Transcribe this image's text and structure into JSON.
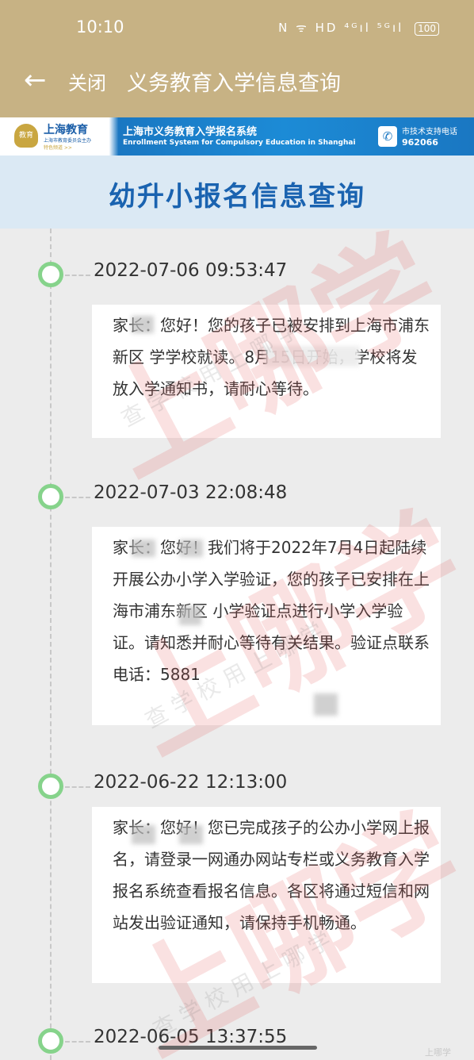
{
  "status_bar": {
    "time": "10:10",
    "icons_text": "N ᯤ HD ⁴ᴳıl ⁵ᴳıl",
    "battery": "100"
  },
  "nav": {
    "back_icon": "arrow-left-icon",
    "close_label": "关闭",
    "title": "义务教育入学信息查询"
  },
  "banner": {
    "logo_text": "教育",
    "brand": "上海教育",
    "brand_sub": "上海市教育委员会主办",
    "brand_sub2": "特色频道 >>",
    "system_title": "上海市义务教育入学报名系统",
    "system_title_en": "Enrollment System for Compulsory Education in Shanghai",
    "phone_icon": "phone-icon",
    "support_label": "市技术支持电话",
    "support_phone": "962066"
  },
  "page_title": "幼升小报名信息查询",
  "timeline": [
    {
      "time": "2022-07-06 09:53:47",
      "message": "家长：您好！您的孩子已被安排到上海市浦东新区 学学校就读。8月15日开始，学校将发放入学通知书，请耐心等待。"
    },
    {
      "time": "2022-07-03 22:08:48",
      "message": "家长：您好！我们将于2022年7月4日起陆续开展公办小学入学验证，您的孩子已安排在上海市浦东新区 小学验证点进行小学入学验证。请知悉并耐心等待有关结果。验证点联系电话：5881"
    },
    {
      "time": "2022-06-22 12:13:00",
      "message": "家长：您好！您已完成孩子的公办小学网上报名，请登录一网通办网站专栏或义务教育入学报名系统查看报名信息。各区将通过短信和网站发出验证通知，请保持手机畅通。"
    },
    {
      "time": "2022-06-05 13:37:55"
    }
  ],
  "watermarks": {
    "large": "上哪学",
    "small_1": "查 学 校 用 上 哪 学",
    "small_2": "查 学 校 用 上 哪 学",
    "small_3": "查 学 校 用 上 哪 学",
    "corner": "上哪学"
  }
}
